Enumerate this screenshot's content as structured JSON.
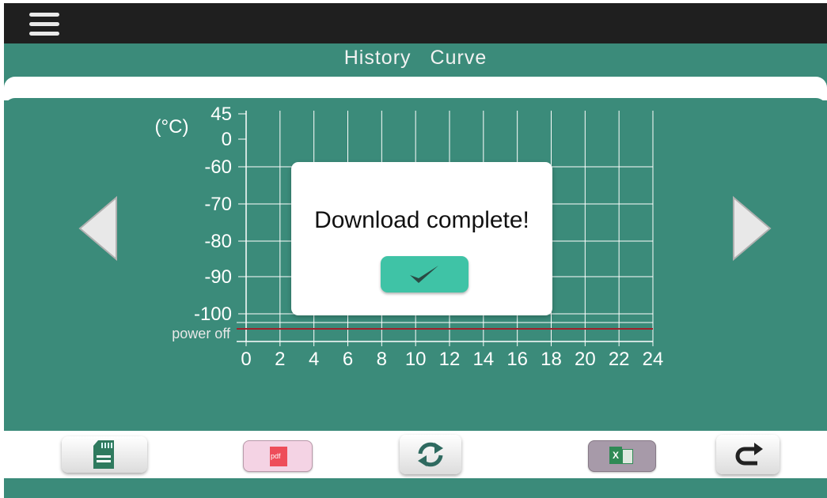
{
  "header": {
    "menu_icon": "hamburger-menu-icon"
  },
  "page": {
    "title_word1": "History",
    "title_word2": "Curve"
  },
  "chart_data": {
    "type": "line",
    "title": "",
    "ylabel": "(°C)",
    "xlabel": "",
    "x_ticks": [
      "0",
      "2",
      "4",
      "6",
      "8",
      "10",
      "12",
      "14",
      "16",
      "18",
      "20",
      "22",
      "24"
    ],
    "xlim": [
      0,
      24
    ],
    "y_ticks": [
      "45",
      "0",
      "-60",
      "-70",
      "-80",
      "-90",
      "-100"
    ],
    "extra_row_label": "power off",
    "grid": true,
    "series": [
      {
        "values": [],
        "color": "#a0202a"
      }
    ],
    "power_off_line": true
  },
  "navigation": {
    "prev_icon": "left-arrow-icon",
    "next_icon": "right-arrow-icon"
  },
  "dialog": {
    "message": "Download complete!",
    "confirm_icon": "checkmark-icon"
  },
  "toolbar": {
    "sd_icon": "sd-card-icon",
    "pdf_icon": "pdf-file-icon",
    "pdf_text": "pdf",
    "refresh_icon": "refresh-icon",
    "excel_icon": "excel-file-icon",
    "excel_text": "X",
    "back_icon": "return-arrow-icon"
  },
  "colors": {
    "background": "#3b8b7a",
    "topbar": "#1f1f1f",
    "confirm_button": "#3fc3a6",
    "power_off_line": "#a0202a",
    "pdf_button": "#f4d3e4",
    "excel_button": "#a79aa9"
  }
}
